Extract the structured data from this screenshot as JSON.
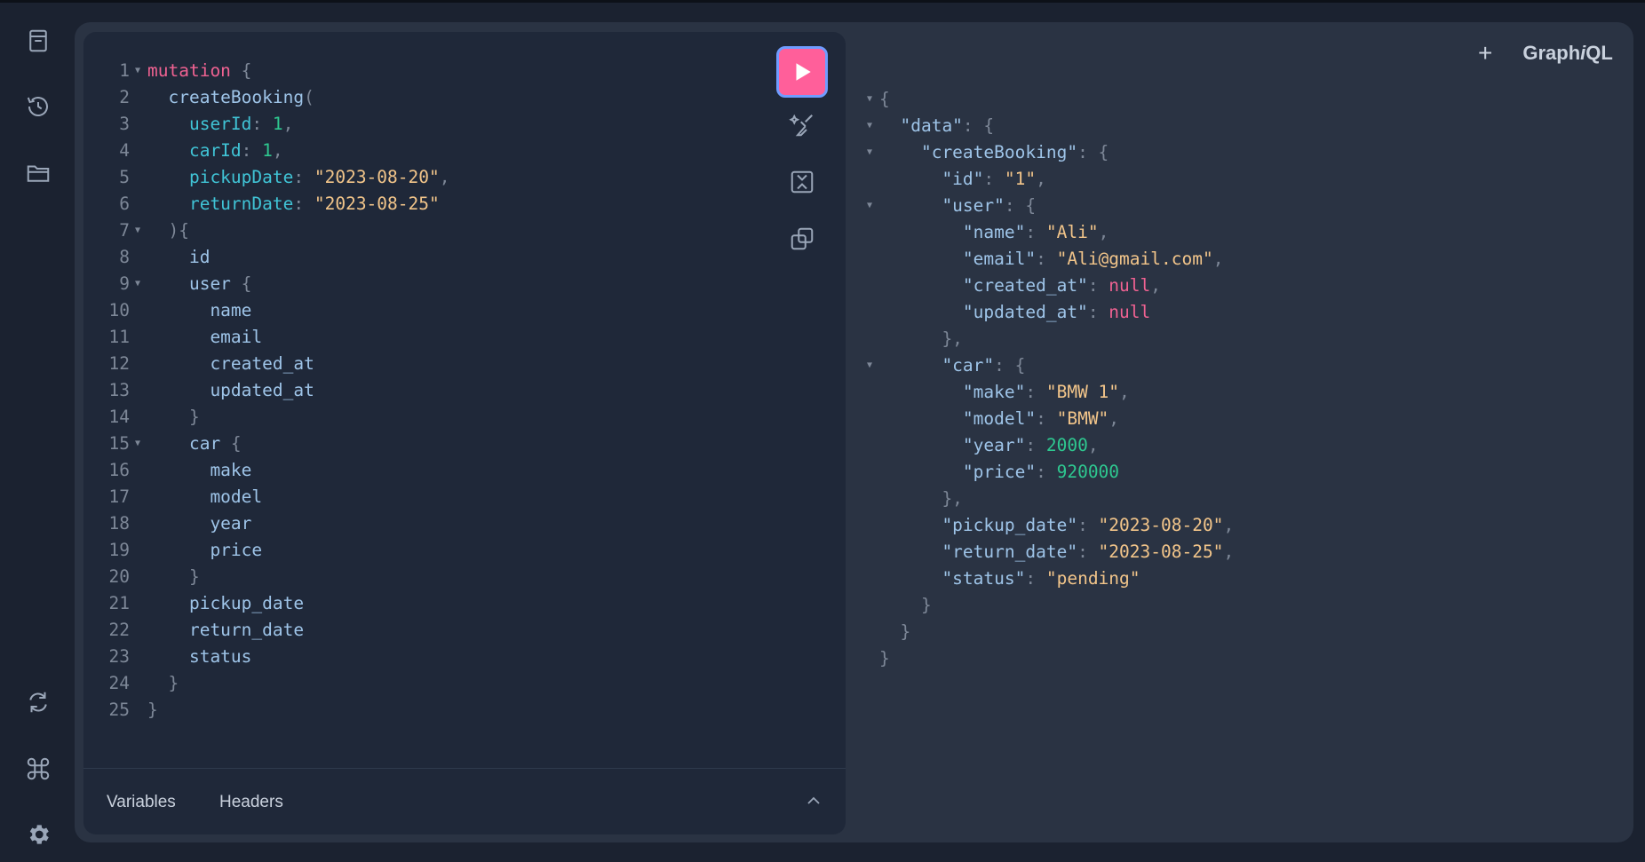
{
  "app": {
    "brand_prefix": "Graph",
    "brand_italic": "i",
    "brand_suffix": "QL"
  },
  "sidebar": {
    "items": [
      {
        "name": "docs-icon"
      },
      {
        "name": "history-icon"
      },
      {
        "name": "explorer-icon"
      },
      {
        "name": "refetch-schema-icon"
      },
      {
        "name": "shortcuts-icon"
      },
      {
        "name": "settings-icon"
      }
    ]
  },
  "editor": {
    "lines": [
      {
        "n": "1",
        "fold": true,
        "tokens": [
          [
            "kw",
            "mutation"
          ],
          [
            "punct",
            " {"
          ]
        ]
      },
      {
        "n": "2",
        "fold": false,
        "tokens": [
          [
            "fn",
            "  createBooking"
          ],
          [
            "punct",
            "("
          ]
        ]
      },
      {
        "n": "3",
        "fold": false,
        "tokens": [
          [
            "arg",
            "    userId"
          ],
          [
            "punct",
            ": "
          ],
          [
            "num",
            "1"
          ],
          [
            "punct",
            ","
          ]
        ]
      },
      {
        "n": "4",
        "fold": false,
        "tokens": [
          [
            "arg",
            "    carId"
          ],
          [
            "punct",
            ": "
          ],
          [
            "num",
            "1"
          ],
          [
            "punct",
            ","
          ]
        ]
      },
      {
        "n": "5",
        "fold": false,
        "tokens": [
          [
            "arg",
            "    pickupDate"
          ],
          [
            "punct",
            ": "
          ],
          [
            "str",
            "\"2023-08-20\""
          ],
          [
            "punct",
            ","
          ]
        ]
      },
      {
        "n": "6",
        "fold": false,
        "tokens": [
          [
            "arg",
            "    returnDate"
          ],
          [
            "punct",
            ": "
          ],
          [
            "str",
            "\"2023-08-25\""
          ]
        ]
      },
      {
        "n": "7",
        "fold": true,
        "tokens": [
          [
            "punct",
            "  ){"
          ]
        ]
      },
      {
        "n": "8",
        "fold": false,
        "tokens": [
          [
            "field",
            "    id"
          ]
        ]
      },
      {
        "n": "9",
        "fold": true,
        "tokens": [
          [
            "field",
            "    user"
          ],
          [
            "punct",
            " {"
          ]
        ]
      },
      {
        "n": "10",
        "fold": false,
        "tokens": [
          [
            "field",
            "      name"
          ]
        ]
      },
      {
        "n": "11",
        "fold": false,
        "tokens": [
          [
            "field",
            "      email"
          ]
        ]
      },
      {
        "n": "12",
        "fold": false,
        "tokens": [
          [
            "field",
            "      created_at"
          ]
        ]
      },
      {
        "n": "13",
        "fold": false,
        "tokens": [
          [
            "field",
            "      updated_at"
          ]
        ]
      },
      {
        "n": "14",
        "fold": false,
        "tokens": [
          [
            "punct",
            "    }"
          ]
        ]
      },
      {
        "n": "15",
        "fold": true,
        "tokens": [
          [
            "field",
            "    car"
          ],
          [
            "punct",
            " {"
          ]
        ]
      },
      {
        "n": "16",
        "fold": false,
        "tokens": [
          [
            "field",
            "      make"
          ]
        ]
      },
      {
        "n": "17",
        "fold": false,
        "tokens": [
          [
            "field",
            "      model"
          ]
        ]
      },
      {
        "n": "18",
        "fold": false,
        "tokens": [
          [
            "field",
            "      year"
          ]
        ]
      },
      {
        "n": "19",
        "fold": false,
        "tokens": [
          [
            "field",
            "      price"
          ]
        ]
      },
      {
        "n": "20",
        "fold": false,
        "tokens": [
          [
            "punct",
            "    }"
          ]
        ]
      },
      {
        "n": "21",
        "fold": false,
        "tokens": [
          [
            "field",
            "    pickup_date"
          ]
        ]
      },
      {
        "n": "22",
        "fold": false,
        "tokens": [
          [
            "field",
            "    return_date"
          ]
        ]
      },
      {
        "n": "23",
        "fold": false,
        "tokens": [
          [
            "field",
            "    status"
          ]
        ]
      },
      {
        "n": "24",
        "fold": false,
        "tokens": [
          [
            "punct",
            "  }"
          ]
        ]
      },
      {
        "n": "25",
        "fold": false,
        "tokens": [
          [
            "punct",
            "}"
          ]
        ]
      }
    ]
  },
  "bottom_tabs": {
    "variables": "Variables",
    "headers": "Headers"
  },
  "result": {
    "lines": [
      {
        "fold": true,
        "tokens": [
          [
            "punct",
            "{"
          ]
        ]
      },
      {
        "fold": true,
        "tokens": [
          [
            "key",
            "  \"data\""
          ],
          [
            "punct",
            ": {"
          ]
        ]
      },
      {
        "fold": true,
        "tokens": [
          [
            "key",
            "    \"createBooking\""
          ],
          [
            "punct",
            ": {"
          ]
        ]
      },
      {
        "fold": false,
        "tokens": [
          [
            "key",
            "      \"id\""
          ],
          [
            "punct",
            ": "
          ],
          [
            "str",
            "\"1\""
          ],
          [
            "punct",
            ","
          ]
        ]
      },
      {
        "fold": true,
        "tokens": [
          [
            "key",
            "      \"user\""
          ],
          [
            "punct",
            ": {"
          ]
        ]
      },
      {
        "fold": false,
        "tokens": [
          [
            "key",
            "        \"name\""
          ],
          [
            "punct",
            ": "
          ],
          [
            "str",
            "\"Ali\""
          ],
          [
            "punct",
            ","
          ]
        ]
      },
      {
        "fold": false,
        "tokens": [
          [
            "key",
            "        \"email\""
          ],
          [
            "punct",
            ": "
          ],
          [
            "str",
            "\"Ali@gmail.com\""
          ],
          [
            "punct",
            ","
          ]
        ]
      },
      {
        "fold": false,
        "tokens": [
          [
            "key",
            "        \"created_at\""
          ],
          [
            "punct",
            ": "
          ],
          [
            "nul",
            "null"
          ],
          [
            "punct",
            ","
          ]
        ]
      },
      {
        "fold": false,
        "tokens": [
          [
            "key",
            "        \"updated_at\""
          ],
          [
            "punct",
            ": "
          ],
          [
            "nul",
            "null"
          ]
        ]
      },
      {
        "fold": false,
        "tokens": [
          [
            "punct",
            "      },"
          ]
        ]
      },
      {
        "fold": true,
        "tokens": [
          [
            "key",
            "      \"car\""
          ],
          [
            "punct",
            ": {"
          ]
        ]
      },
      {
        "fold": false,
        "tokens": [
          [
            "key",
            "        \"make\""
          ],
          [
            "punct",
            ": "
          ],
          [
            "str",
            "\"BMW 1\""
          ],
          [
            "punct",
            ","
          ]
        ]
      },
      {
        "fold": false,
        "tokens": [
          [
            "key",
            "        \"model\""
          ],
          [
            "punct",
            ": "
          ],
          [
            "str",
            "\"BMW\""
          ],
          [
            "punct",
            ","
          ]
        ]
      },
      {
        "fold": false,
        "tokens": [
          [
            "key",
            "        \"year\""
          ],
          [
            "punct",
            ": "
          ],
          [
            "num",
            "2000"
          ],
          [
            "punct",
            ","
          ]
        ]
      },
      {
        "fold": false,
        "tokens": [
          [
            "key",
            "        \"price\""
          ],
          [
            "punct",
            ": "
          ],
          [
            "num",
            "920000"
          ]
        ]
      },
      {
        "fold": false,
        "tokens": [
          [
            "punct",
            "      },"
          ]
        ]
      },
      {
        "fold": false,
        "tokens": [
          [
            "key",
            "      \"pickup_date\""
          ],
          [
            "punct",
            ": "
          ],
          [
            "str",
            "\"2023-08-20\""
          ],
          [
            "punct",
            ","
          ]
        ]
      },
      {
        "fold": false,
        "tokens": [
          [
            "key",
            "      \"return_date\""
          ],
          [
            "punct",
            ": "
          ],
          [
            "str",
            "\"2023-08-25\""
          ],
          [
            "punct",
            ","
          ]
        ]
      },
      {
        "fold": false,
        "tokens": [
          [
            "key",
            "      \"status\""
          ],
          [
            "punct",
            ": "
          ],
          [
            "str",
            "\"pending\""
          ]
        ]
      },
      {
        "fold": false,
        "tokens": [
          [
            "punct",
            "    }"
          ]
        ]
      },
      {
        "fold": false,
        "tokens": [
          [
            "punct",
            "  }"
          ]
        ]
      },
      {
        "fold": false,
        "tokens": [
          [
            "punct",
            "}"
          ]
        ]
      }
    ]
  },
  "colors": {
    "run_button": "#ff5f9a",
    "accent_border": "#6f9cff"
  }
}
